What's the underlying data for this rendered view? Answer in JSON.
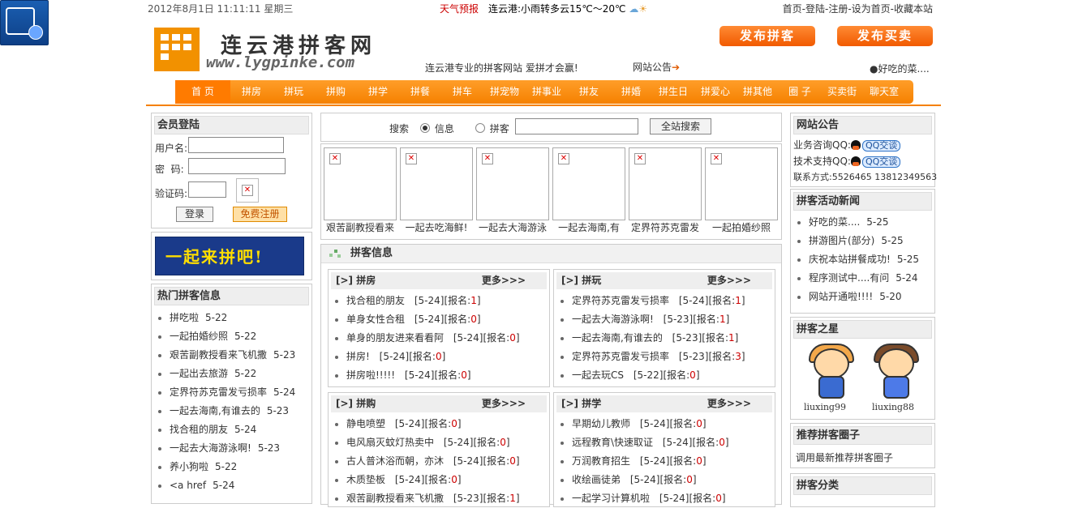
{
  "topbar": {
    "date": "2012年8月1日  11:11:11  星期三",
    "weather_label": "天气预报",
    "weather": "连云港:小雨转多云15℃～20℃",
    "links": "首页-登陆-注册-设为首页-收藏本站"
  },
  "logo": {
    "title": "连云港拼客网",
    "url": "www.lygpinke.com"
  },
  "header": {
    "publish_pinke": "发布拼客",
    "publish_trade": "发布买卖",
    "slogan": "连云港专业的拼客网站 爱拼才会赢!",
    "notice": "网站公告",
    "ticker": "●好吃的菜...."
  },
  "nav": [
    "首 页",
    "拼房",
    "拼玩",
    "拼购",
    "拼学",
    "拼餐",
    "拼车",
    "拼宠物",
    "拼事业",
    "拼友",
    "拼婚",
    "拼生日",
    "拼爱心",
    "拼其他",
    "圈 子",
    "买卖街",
    "聊天室"
  ],
  "login": {
    "title": "会员登陆",
    "username_label": "用户名:",
    "password_label": "密  码:",
    "captcha_label": "验证码:",
    "login_button": "登录",
    "register_button": "免费注册"
  },
  "banner_text": "一起来拼吧!",
  "hot": {
    "title": "热门拼客信息",
    "items": [
      {
        "t": "拼吃啦",
        "d": "5-22"
      },
      {
        "t": "一起拍婚纱照",
        "d": "5-22"
      },
      {
        "t": "艰苦副教授看来飞机撒",
        "d": "5-23"
      },
      {
        "t": "一起出去旅游",
        "d": "5-22"
      },
      {
        "t": "定界符苏克雷发亏损率",
        "d": "5-24"
      },
      {
        "t": "一起去海南,有谁去的",
        "d": "5-23"
      },
      {
        "t": "找合租的朋友",
        "d": "5-24"
      },
      {
        "t": "一起去大海游泳啊!",
        "d": "5-23"
      },
      {
        "t": "养小狗啦",
        "d": "5-22"
      },
      {
        "t": "<a href",
        "d": "5-24"
      }
    ]
  },
  "search": {
    "label": "搜索",
    "opt_info": "信息",
    "opt_pinke": "拼客",
    "button": "全站搜索"
  },
  "thumbs": [
    "艰苦副教授看来",
    "一起去吃海鲜!",
    "一起去大海游泳",
    "一起去海南,有",
    "定界符苏克雷发",
    "一起拍婚纱照"
  ],
  "info": {
    "title": "拼客信息",
    "more": "更多>>>",
    "cats": [
      {
        "name": "[>] 拼房",
        "items": [
          {
            "t": "找合租的朋友",
            "d": "[5-24]",
            "n": "1"
          },
          {
            "t": "单身女性合租",
            "d": "[5-24]",
            "n": "0"
          },
          {
            "t": "单身的朋友进来看看阿",
            "d": "[5-24]",
            "n": "0"
          },
          {
            "t": "拼房!",
            "d": "[5-24]",
            "n": "0"
          },
          {
            "t": "拼房啦!!!!!",
            "d": "[5-24]",
            "n": "0"
          }
        ]
      },
      {
        "name": "[>] 拼玩",
        "items": [
          {
            "t": "定界符苏克雷发亏损率",
            "d": "[5-24]",
            "n": "1"
          },
          {
            "t": "一起去大海游泳啊!",
            "d": "[5-23]",
            "n": "1"
          },
          {
            "t": "一起去海南,有谁去的",
            "d": "[5-23]",
            "n": "1"
          },
          {
            "t": "定界符苏克雷发亏损率",
            "d": "[5-23]",
            "n": "3"
          },
          {
            "t": "一起去玩CS",
            "d": "[5-22]",
            "n": "0"
          }
        ]
      },
      {
        "name": "[>] 拼购",
        "items": [
          {
            "t": "静电喷塑",
            "d": "[5-24]",
            "n": "0"
          },
          {
            "t": "电风扇灭蚊灯热卖中",
            "d": "[5-24]",
            "n": "0"
          },
          {
            "t": "古人普沐浴而朝，亦沐",
            "d": "[5-24]",
            "n": "0"
          },
          {
            "t": "木质垫板",
            "d": "[5-24]",
            "n": "0"
          },
          {
            "t": "艰苦副教授看来飞机撒",
            "d": "[5-23]",
            "n": "1"
          }
        ]
      },
      {
        "name": "[>] 拼学",
        "items": [
          {
            "t": "早期幼儿教师",
            "d": "[5-24]",
            "n": "0"
          },
          {
            "t": "远程教育\\快速取证",
            "d": "[5-24]",
            "n": "0"
          },
          {
            "t": "万润教育招生",
            "d": "[5-24]",
            "n": "0"
          },
          {
            "t": "收绘画徒弟",
            "d": "[5-24]",
            "n": "0"
          },
          {
            "t": "一起学习计算机啦",
            "d": "[5-24]",
            "n": "0"
          }
        ]
      }
    ],
    "signup_label": "[报名:",
    "signup_close": "]"
  },
  "notice_box": {
    "title": "网站公告",
    "biz": "业务咨询QQ:",
    "tech": "技术支持QQ:",
    "qq_btn": "QQ交谈",
    "contact": "联系方式:5526465 13812349563"
  },
  "news": {
    "title": "拼客活动新闻",
    "items": [
      {
        "t": "好吃的菜....",
        "d": "5-25"
      },
      {
        "t": "拼游图片(部分)",
        "d": "5-25"
      },
      {
        "t": "庆祝本站拼餐成功!",
        "d": "5-25"
      },
      {
        "t": "程序测试中....有问",
        "d": "5-24"
      },
      {
        "t": "网站开通啦!!!!",
        "d": "5-20"
      }
    ]
  },
  "stars": {
    "title": "拼客之星",
    "names": [
      "liuxing99",
      "liuxing88"
    ]
  },
  "circle": {
    "title": "推荐拼客圈子",
    "text": "调用最新推荐拼客圈子"
  },
  "category": {
    "title": "拼客分类"
  }
}
